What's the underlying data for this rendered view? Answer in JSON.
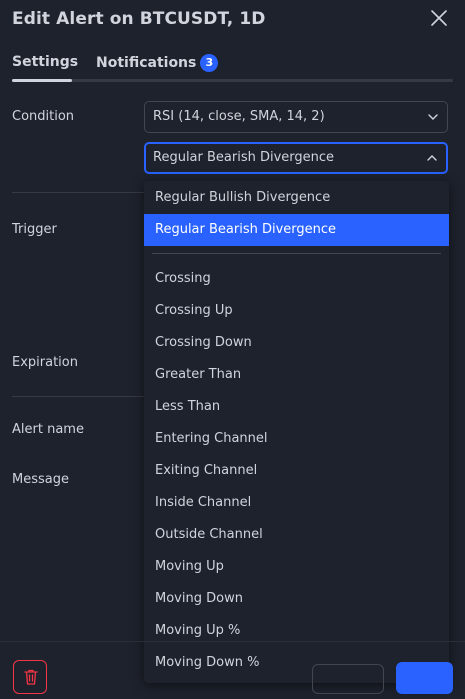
{
  "header": {
    "title": "Edit Alert on BTCUSDT, 1D"
  },
  "tabs": {
    "settings": "Settings",
    "notifications": "Notifications",
    "notifications_badge": "3"
  },
  "labels": {
    "condition": "Condition",
    "trigger": "Trigger",
    "expiration": "Expiration",
    "alert_name": "Alert name",
    "message": "Message"
  },
  "condition": {
    "source_value": "RSI (14, close, SMA, 14, 2)",
    "operator_value": "Regular Bearish Divergence"
  },
  "dropdown": {
    "selected_index": 1,
    "group1": [
      "Regular Bullish Divergence",
      "Regular Bearish Divergence"
    ],
    "group2": [
      "Crossing",
      "Crossing Up",
      "Crossing Down",
      "Greater Than",
      "Less Than",
      "Entering Channel",
      "Exiting Channel",
      "Inside Channel",
      "Outside Channel",
      "Moving Up",
      "Moving Down",
      "Moving Up %",
      "Moving Down %"
    ]
  },
  "colors": {
    "background": "#1e222d",
    "text": "#d1d4dc",
    "accent": "#2962ff",
    "danger": "#f23645",
    "border": "#434651"
  }
}
